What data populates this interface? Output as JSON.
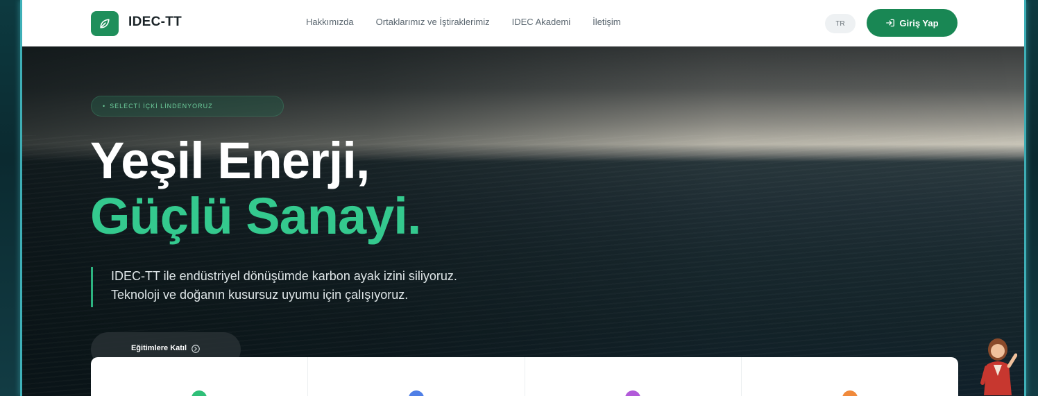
{
  "nav": {
    "brand": "IDEC-TT",
    "links": [
      "Hakkımızda",
      "Ortaklarımız ve İştiraklerimiz",
      "IDEC Akademi",
      "İletişim"
    ],
    "language": "TR",
    "login_label": "Giriş Yap"
  },
  "hero": {
    "tag": "SELECTİ İÇKİ LİNDENYORUZ",
    "title_line1": "Yeşil Enerji,",
    "title_line2": "Güçlü Sanayi.",
    "description": [
      "IDEC-TT ile endüstriyel dönüşümde karbon ayak izini siliyoruz.",
      "Teknoloji ve doğanın kusursuz uyumu için çalışıyoruz."
    ],
    "cta_label": "Eğitimlere Katıl"
  },
  "colors": {
    "brand_green": "#198754",
    "accent_green": "#34c98e",
    "feature_icons": [
      "#2fbf78",
      "#4f7fe6",
      "#b25ad9",
      "#f08a3c"
    ]
  },
  "icons": {
    "logo": "leaf-icon",
    "login": "login-arrow-icon",
    "cta": "arrow-right-circle-icon"
  }
}
